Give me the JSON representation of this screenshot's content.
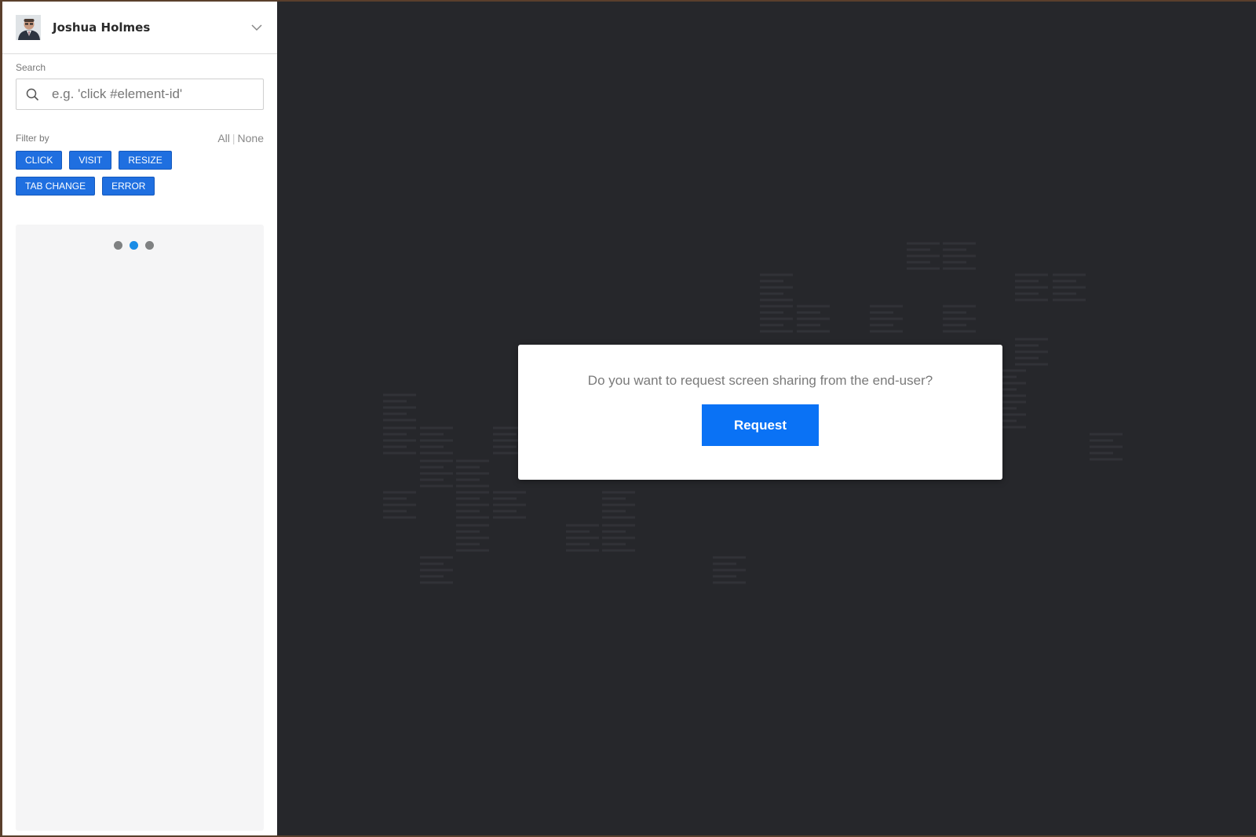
{
  "user": {
    "name": "Joshua Holmes"
  },
  "search": {
    "label": "Search",
    "placeholder": "e.g. 'click #element-id'"
  },
  "filter": {
    "label": "Filter by",
    "all_label": "All",
    "separator": "|",
    "none_label": "None",
    "buttons": [
      "CLICK",
      "VISIT",
      "RESIZE",
      "TAB CHANGE",
      "ERROR"
    ]
  },
  "dialog": {
    "message": "Do you want to request screen sharing from the end-user?",
    "button_label": "Request"
  },
  "colors": {
    "accent": "#1f6fe0",
    "request_button": "#0a72f5",
    "main_background": "#26272b",
    "loader_active": "#1a8ce6"
  }
}
